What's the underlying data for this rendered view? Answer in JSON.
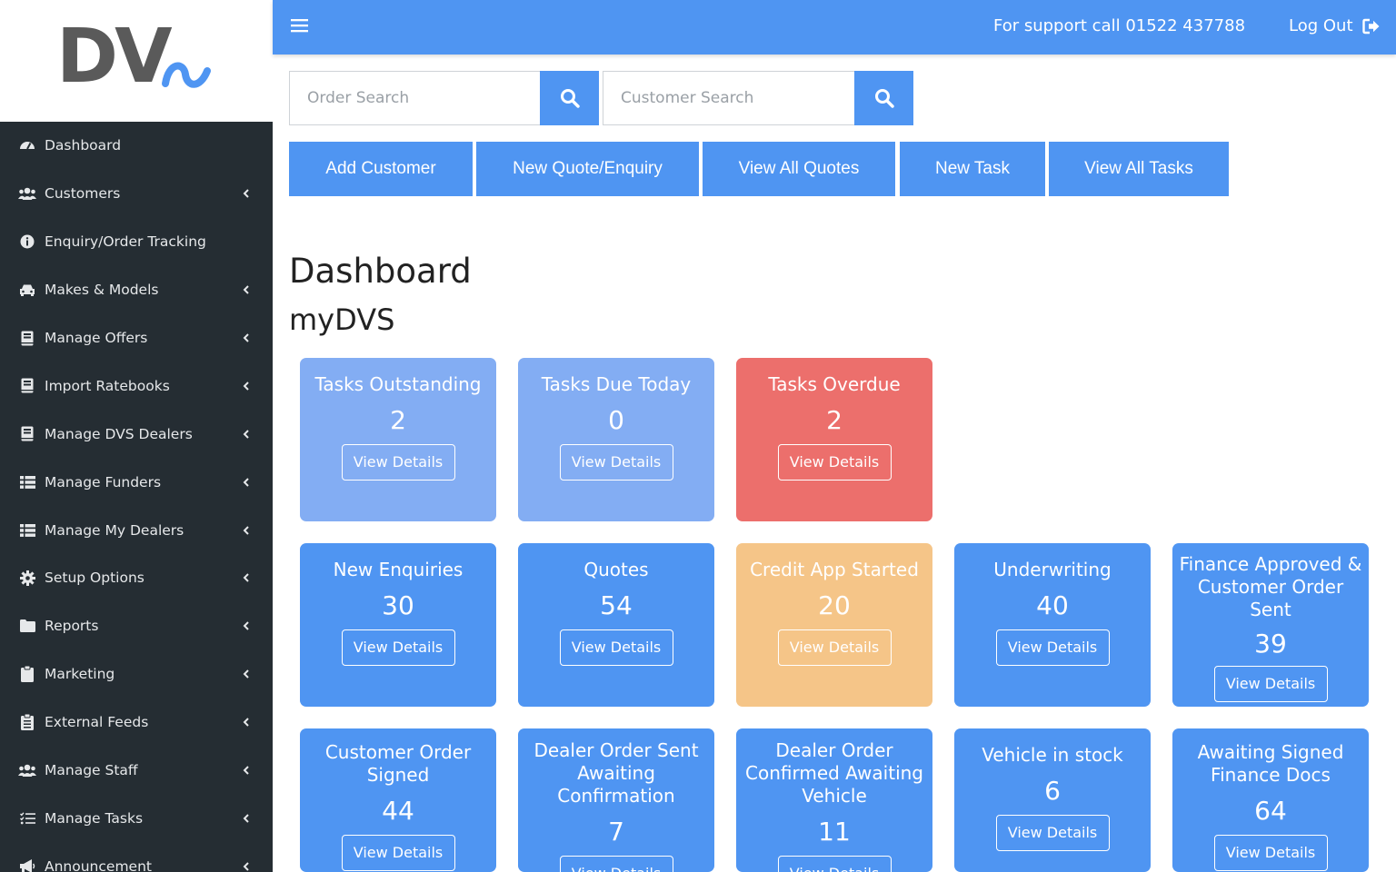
{
  "brand": {
    "logo_text": "DVS"
  },
  "sidebar": {
    "items": [
      {
        "label": "Dashboard",
        "icon": "tachometer-icon",
        "has_submenu": false
      },
      {
        "label": "Customers",
        "icon": "users-icon",
        "has_submenu": true
      },
      {
        "label": "Enquiry/Order Tracking",
        "icon": "info-circle-icon",
        "has_submenu": false
      },
      {
        "label": "Makes & Models",
        "icon": "car-icon",
        "has_submenu": true
      },
      {
        "label": "Manage Offers",
        "icon": "book-icon",
        "has_submenu": true
      },
      {
        "label": "Import Ratebooks",
        "icon": "book-icon",
        "has_submenu": true
      },
      {
        "label": "Manage DVS Dealers",
        "icon": "book-icon",
        "has_submenu": true
      },
      {
        "label": "Manage Funders",
        "icon": "list-icon",
        "has_submenu": true
      },
      {
        "label": "Manage My Dealers",
        "icon": "list-icon",
        "has_submenu": true
      },
      {
        "label": "Setup Options",
        "icon": "gear-icon",
        "has_submenu": true
      },
      {
        "label": "Reports",
        "icon": "folder-icon",
        "has_submenu": true
      },
      {
        "label": "Marketing",
        "icon": "clipboard-icon",
        "has_submenu": true
      },
      {
        "label": "External Feeds",
        "icon": "clipboard-list-icon",
        "has_submenu": true
      },
      {
        "label": "Manage Staff",
        "icon": "users-icon",
        "has_submenu": true
      },
      {
        "label": "Manage Tasks",
        "icon": "tasks-icon",
        "has_submenu": true
      },
      {
        "label": "Announcement",
        "icon": "bullhorn-icon",
        "has_submenu": true
      }
    ]
  },
  "topbar": {
    "support_text": "For support call 01522 437788",
    "logout_label": "Log Out"
  },
  "search": {
    "order_placeholder": "Order Search",
    "order_value": "",
    "customer_placeholder": "Customer Search",
    "customer_value": ""
  },
  "actions": {
    "add_customer": "Add Customer",
    "new_quote": "New Quote/Enquiry",
    "view_quotes": "View All Quotes",
    "new_task": "New Task",
    "view_tasks": "View All Tasks"
  },
  "page": {
    "title": "Dashboard",
    "subtitle": "myDVS"
  },
  "cards": [
    {
      "title": "Tasks Outstanding",
      "count": "2",
      "button": "View Details",
      "color": "#83adf3"
    },
    {
      "title": "Tasks Due Today",
      "count": "0",
      "button": "View Details",
      "color": "#83adf3"
    },
    {
      "title": "Tasks Overdue",
      "count": "2",
      "button": "View Details",
      "color": "#ec6f6c"
    },
    {
      "title": "New Enquiries",
      "count": "30",
      "button": "View Details",
      "color": "#4f95f2"
    },
    {
      "title": "Quotes",
      "count": "54",
      "button": "View Details",
      "color": "#4f95f2"
    },
    {
      "title": "Credit App Started",
      "count": "20",
      "button": "View Details",
      "color": "#f5c588"
    },
    {
      "title": "Underwriting",
      "count": "40",
      "button": "View Details",
      "color": "#4f95f2"
    },
    {
      "title": "Finance Approved & Customer Order Sent",
      "count": "39",
      "button": "View Details",
      "color": "#4f95f2"
    },
    {
      "title": "Customer Order Signed",
      "count": "44",
      "button": "View Details",
      "color": "#4f95f2"
    },
    {
      "title": "Dealer Order Sent Awaiting Confirmation",
      "count": "7",
      "button": "View Details",
      "color": "#4f95f2"
    },
    {
      "title": "Dealer Order Confirmed Awaiting Vehicle",
      "count": "11",
      "button": "View Details",
      "color": "#4f95f2"
    },
    {
      "title": "Vehicle in stock",
      "count": "6",
      "button": "View Details",
      "color": "#4f95f2"
    },
    {
      "title": "Awaiting Signed Finance Docs",
      "count": "64",
      "button": "View Details",
      "color": "#4f95f2"
    }
  ]
}
